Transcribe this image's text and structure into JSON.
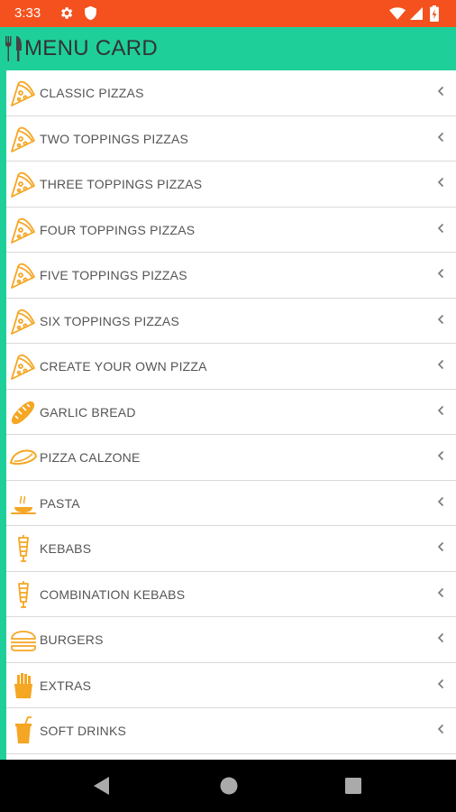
{
  "status_bar": {
    "time": "3:33"
  },
  "app_bar": {
    "title": "MENU CARD"
  },
  "menu": {
    "items": [
      {
        "label": "CLASSIC PIZZAS",
        "icon": "pizza-slice-icon"
      },
      {
        "label": "TWO TOPPINGS PIZZAS",
        "icon": "pizza-slice-icon"
      },
      {
        "label": "THREE TOPPINGS PIZZAS",
        "icon": "pizza-slice-icon"
      },
      {
        "label": "FOUR TOPPINGS PIZZAS",
        "icon": "pizza-slice-icon"
      },
      {
        "label": "FIVE TOPPINGS PIZZAS",
        "icon": "pizza-slice-icon"
      },
      {
        "label": "SIX TOPPINGS PIZZAS",
        "icon": "pizza-slice-icon"
      },
      {
        "label": "CREATE YOUR OWN PIZZA",
        "icon": "pizza-slice-icon"
      },
      {
        "label": "GARLIC BREAD",
        "icon": "bread-icon"
      },
      {
        "label": "PIZZA CALZONE",
        "icon": "calzone-icon"
      },
      {
        "label": "PASTA",
        "icon": "pasta-dish-icon"
      },
      {
        "label": "KEBABS",
        "icon": "kebab-icon"
      },
      {
        "label": "COMBINATION KEBABS",
        "icon": "kebab-icon"
      },
      {
        "label": "BURGERS",
        "icon": "burger-icon"
      },
      {
        "label": "EXTRAS",
        "icon": "fries-icon"
      },
      {
        "label": "SOFT DRINKS",
        "icon": "soft-drink-icon"
      }
    ]
  },
  "colors": {
    "status_bar": "#f4511e",
    "accent": "#1ecf9a",
    "icon": "#f5a623",
    "label": "#555555",
    "divider": "#d9d9d9",
    "nav_bar": "#000000"
  }
}
